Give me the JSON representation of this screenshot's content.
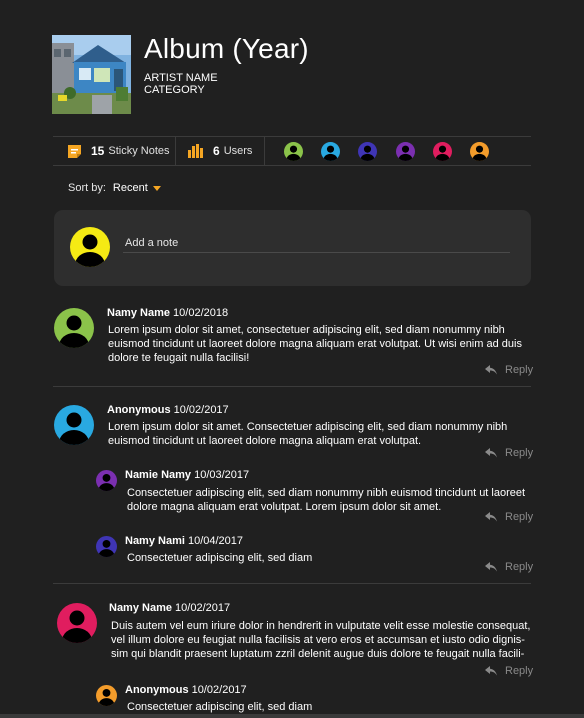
{
  "album": {
    "title": "Album (Year)",
    "artist": "ARTIST NAME",
    "category": "CATEGORY"
  },
  "stats": {
    "notes_count": "15",
    "notes_label": "Sticky Notes",
    "users_count": "6",
    "users_label": "Users",
    "user_colors": [
      "#8bc34a",
      "#29a9e1",
      "#3f35b5",
      "#7b2fb0",
      "#e01d5f",
      "#f39c2b"
    ]
  },
  "sort": {
    "label": "Sort by:",
    "value": "Recent"
  },
  "composer": {
    "placeholder": "Add a note",
    "avatar_color": "#f5ea14"
  },
  "reply_label": "Reply",
  "comments": [
    {
      "name": "Namy Name",
      "date": "10/02/2018",
      "avatar_color": "#8bc34a",
      "lines": [
        "Lorem ipsum dolor sit amet, consectetuer adipiscing elit, sed diam nonummy nibh",
        "euismod tincidunt ut laoreet dolore magna aliquam erat volutpat. Ut wisi enim ad duis",
        "dolore te feugait nulla facilisi!"
      ]
    },
    {
      "name": "Anonymous",
      "date": "10/02/2017",
      "avatar_color": "#29a9e1",
      "lines": [
        "Lorem ipsum dolor sit amet. Consectetuer adipiscing elit, sed diam nonummy nibh",
        "euismod tincidunt ut laoreet dolore magna aliquam erat volutpat."
      ],
      "replies": [
        {
          "name": "Namie Namy",
          "date": "10/03/2017",
          "avatar_color": "#7b2fb0",
          "lines": [
            "Consectetuer adipiscing elit, sed diam nonummy nibh euismod tincidunt ut laoreet",
            "dolore magna aliquam erat volutpat. Lorem ipsum dolor sit amet."
          ]
        },
        {
          "name": "Namy Nami",
          "date": "10/04/2017",
          "avatar_color": "#3f35b5",
          "lines": [
            "Consectetuer adipiscing elit, sed diam"
          ]
        }
      ]
    },
    {
      "name": "Namy Name",
      "date": "10/02/2017",
      "avatar_color": "#e01d5f",
      "lines": [
        "Duis autem vel eum iriure dolor in hendrerit in vulputate velit esse molestie consequat,",
        "vel illum dolore eu feugiat nulla facilisis at vero eros et accumsan et iusto odio dignis-",
        "sim qui blandit praesent luptatum zzril delenit augue duis dolore te feugait nulla facili-"
      ],
      "replies": [
        {
          "name": "Anonymous",
          "date": "10/02/2017",
          "avatar_color": "#f39c2b",
          "lines": [
            "Consectetuer adipiscing elit, sed diam"
          ]
        }
      ]
    }
  ]
}
